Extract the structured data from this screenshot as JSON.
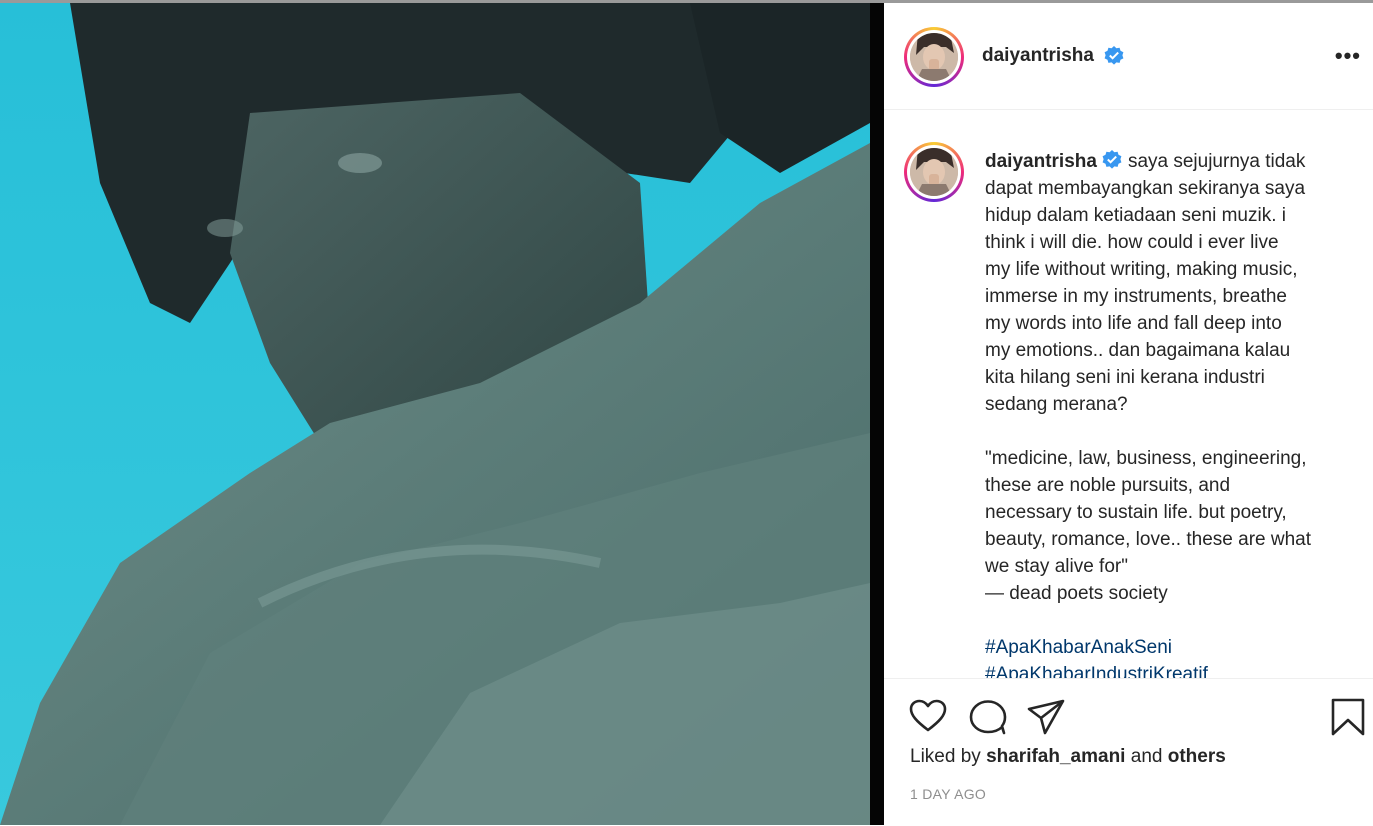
{
  "post": {
    "username": "daiyantrisha",
    "verified": true,
    "more_label": "•••"
  },
  "caption": {
    "username": "daiyantrisha",
    "text": "saya sejujurnya tidak\ndapat membayangkan sekiranya saya\nhidup dalam ketiadaan seni muzik. i\nthink i will die. how could i ever live\nmy life without writing, making music,\nimmerse in my instruments, breathe\nmy words into life and fall deep into\nmy emotions.. dan bagaimana kalau\nkita hilang seni ini kerana industri\nsedang merana?\n\n\"medicine, law, business, engineering,\nthese are noble pursuits, and\nnecessary to sustain life. but poetry,\nbeauty, romance, love.. these are what\nwe stay alive for\"\n— dead poets society",
    "hashtags": [
      "#ApaKhabarAnakSeni",
      "#ApaKhabarIndustriKreatif"
    ]
  },
  "actions": {
    "like_icon": "heart-outline",
    "comment_icon": "speech-bubble",
    "share_icon": "paper-plane",
    "save_icon": "bookmark-outline"
  },
  "likes": {
    "prefix": "Liked by",
    "user": "sharifah_amani",
    "and": "and",
    "others": "others"
  },
  "timestamp": "1 DAY AGO",
  "colors": {
    "verified_blue": "#3897f0",
    "hashtag": "#00376b",
    "muted": "#8e8e8e",
    "media_cyan": "#2fc4dc"
  }
}
